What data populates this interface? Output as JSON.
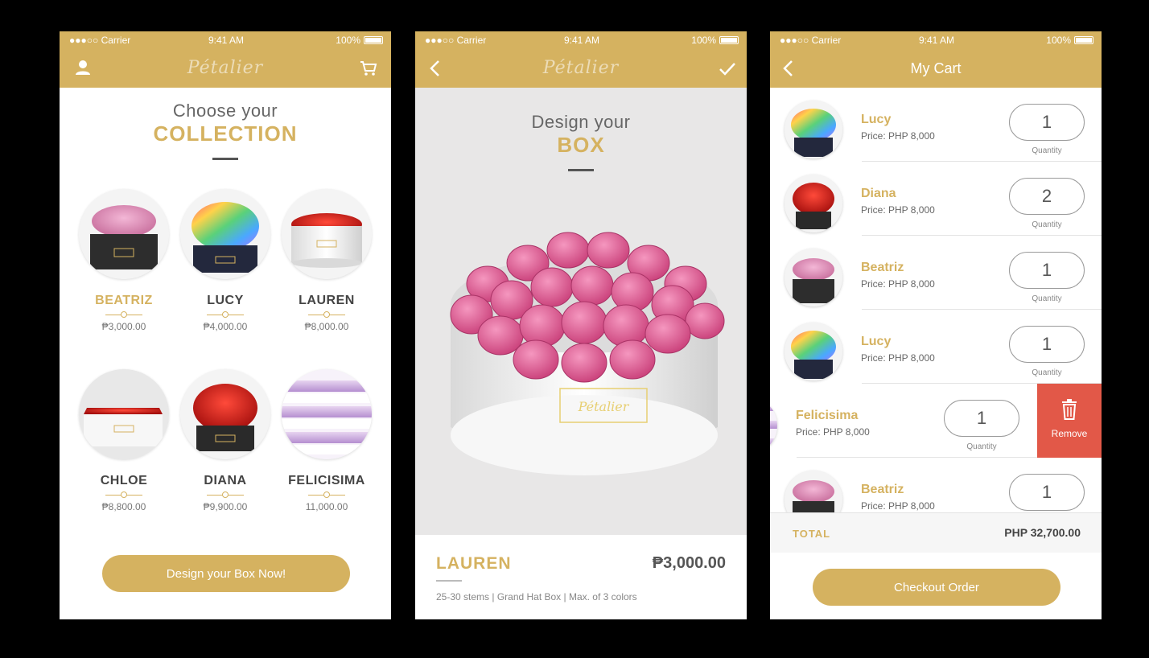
{
  "status_bar": {
    "carrier": "●●●○○ Carrier",
    "time": "9:41 AM",
    "battery": "100%"
  },
  "brand": {
    "logo_text": "Pétalier",
    "accent_color": "#d5b260",
    "remove_color": "#e25848"
  },
  "screen1": {
    "heading_line1": "Choose your",
    "heading_line2": "COLLECTION",
    "roses": [
      {
        "name": "BEATRIZ",
        "price": "₱3,000.00",
        "active": true
      },
      {
        "name": "LUCY",
        "price": "₱4,000.00",
        "active": false
      },
      {
        "name": "LAUREN",
        "price": "₱8,000.00",
        "active": false
      },
      {
        "name": "CHLOE",
        "price": "₱8,800.00",
        "active": false
      },
      {
        "name": "DIANA",
        "price": "₱9,900.00",
        "active": false
      },
      {
        "name": "FELICISIMA",
        "price": "11,000.00",
        "active": false
      }
    ],
    "cta_label": "Design your Box Now!"
  },
  "screen2": {
    "heading_line1": "Design your",
    "heading_line2": "BOX",
    "product_name": "LAUREN",
    "product_price": "₱3,000.00",
    "product_details": "25-30 stems | Grand Hat Box | Max. of 3 colors"
  },
  "screen3": {
    "title": "My Cart",
    "quantity_label": "Quantity",
    "remove_label": "Remove",
    "items": [
      {
        "name": "Lucy",
        "price": "Price: PHP 8,000",
        "qty": "1"
      },
      {
        "name": "Diana",
        "price": "Price: PHP 8,000",
        "qty": "2"
      },
      {
        "name": "Beatriz",
        "price": "Price: PHP 8,000",
        "qty": "1"
      },
      {
        "name": "Lucy",
        "price": "Price: PHP 8,000",
        "qty": "1"
      },
      {
        "name": "Felicisima",
        "price": "Price: PHP 8,000",
        "qty": "1"
      },
      {
        "name": "Beatriz",
        "price": "Price: PHP 8,000",
        "qty": "1"
      }
    ],
    "total_label": "TOTAL",
    "total_value": "PHP 32,700.00",
    "checkout_label": "Checkout Order"
  }
}
